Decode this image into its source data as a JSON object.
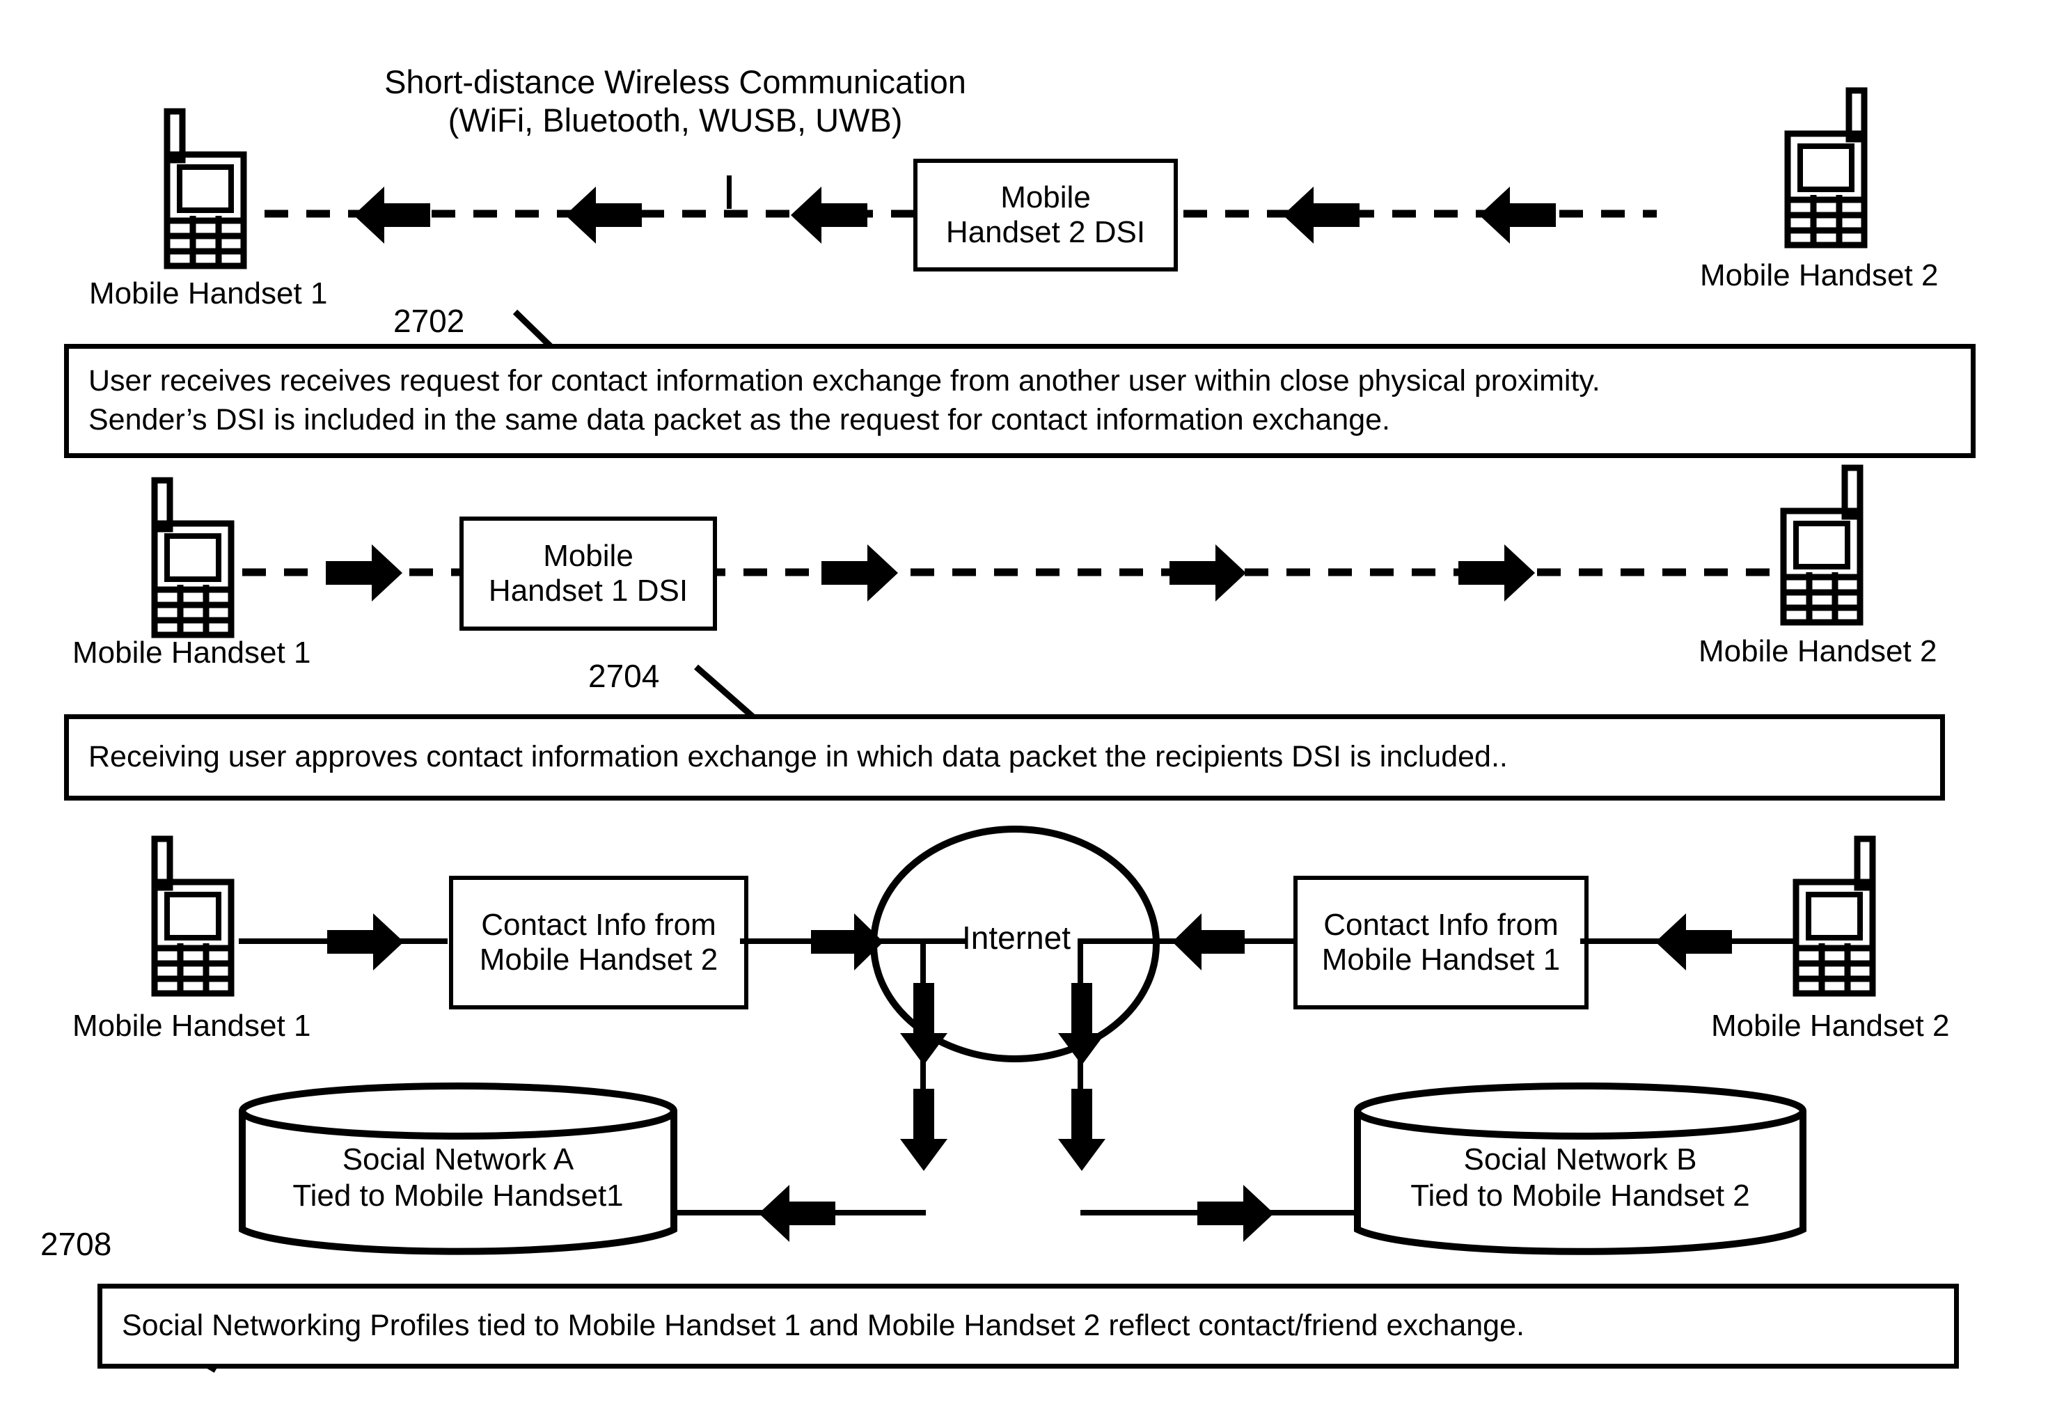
{
  "figure": {
    "title_line1": "Short-distance Wireless Communication",
    "title_line2": "(WiFi, Bluetooth, WUSB, UWB)"
  },
  "labels": {
    "handset1": "Mobile Handset 1",
    "handset2": "Mobile Handset 2",
    "internet": "Internet"
  },
  "boxes": {
    "handset2_dsi_line1": "Mobile",
    "handset2_dsi_line2": "Handset 2 DSI",
    "handset1_dsi_line1": "Mobile",
    "handset1_dsi_line2": "Handset 1 DSI",
    "contact_from_2_line1": "Contact Info from",
    "contact_from_2_line2": "Mobile Handset 2",
    "contact_from_1_line1": "Contact Info from",
    "contact_from_1_line2": "Mobile Handset 1"
  },
  "databases": {
    "social_a_line1": "Social Network A",
    "social_a_line2": "Tied to Mobile Handset1",
    "social_b_line1": "Social Network B",
    "social_b_line2": "Tied to Mobile Handset 2"
  },
  "callouts": {
    "ref_2702": "2702",
    "ref_2704": "2704",
    "ref_2708": "2708"
  },
  "steps": {
    "step1_line1": "User receives receives request for contact information exchange from another user within close physical proximity.",
    "step1_line2": "Sender’s DSI is included in the same data packet as the request for contact information exchange.",
    "step2_line1": "Receiving user approves contact information exchange in which data packet the recipients DSI is included..",
    "step3_line1": "Social Networking Profiles tied to Mobile Handset 1 and Mobile Handset 2 reflect contact/friend exchange."
  },
  "colors": {
    "ink": "#000000",
    "paper": "#ffffff"
  },
  "icons": {
    "handset": "mobile-handset-icon",
    "cloud": "internet-circle-icon",
    "database": "database-cylinder-icon",
    "arrow_left": "block-arrow-left-icon",
    "arrow_right": "block-arrow-right-icon",
    "arrow_down": "block-arrow-down-icon"
  }
}
